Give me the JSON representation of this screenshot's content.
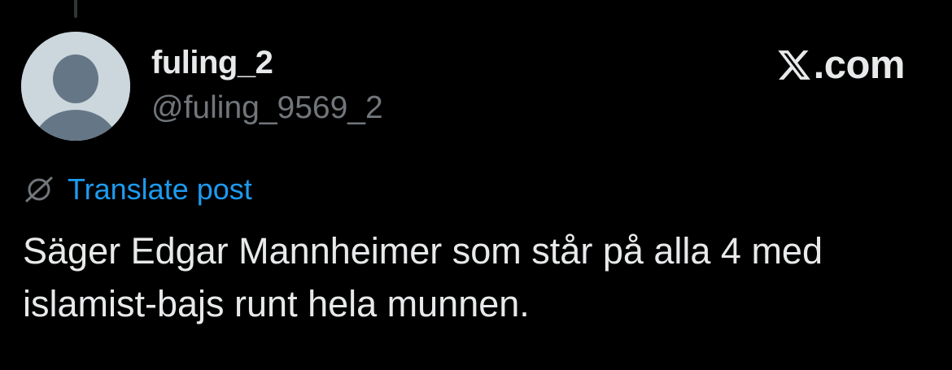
{
  "post": {
    "author": {
      "display_name": "fuling_2",
      "handle": "@fuling_9569_2",
      "avatar_icon": "default-profile-silhouette-icon"
    },
    "brand": {
      "icon": "x-logo-icon",
      "domain": ".com"
    },
    "translate": {
      "icon": "globe-slash-icon",
      "label": "Translate post"
    },
    "text": "Säger Edgar Mannheimer som står på alla 4 med\nislamist-bajs runt hela munnen."
  },
  "colors": {
    "background": "#000000",
    "primary_text": "#e7e9ea",
    "secondary_text": "#71767b",
    "link": "#1d9bf0",
    "avatar_bg": "#ccd6dd",
    "avatar_fg": "#657786"
  }
}
